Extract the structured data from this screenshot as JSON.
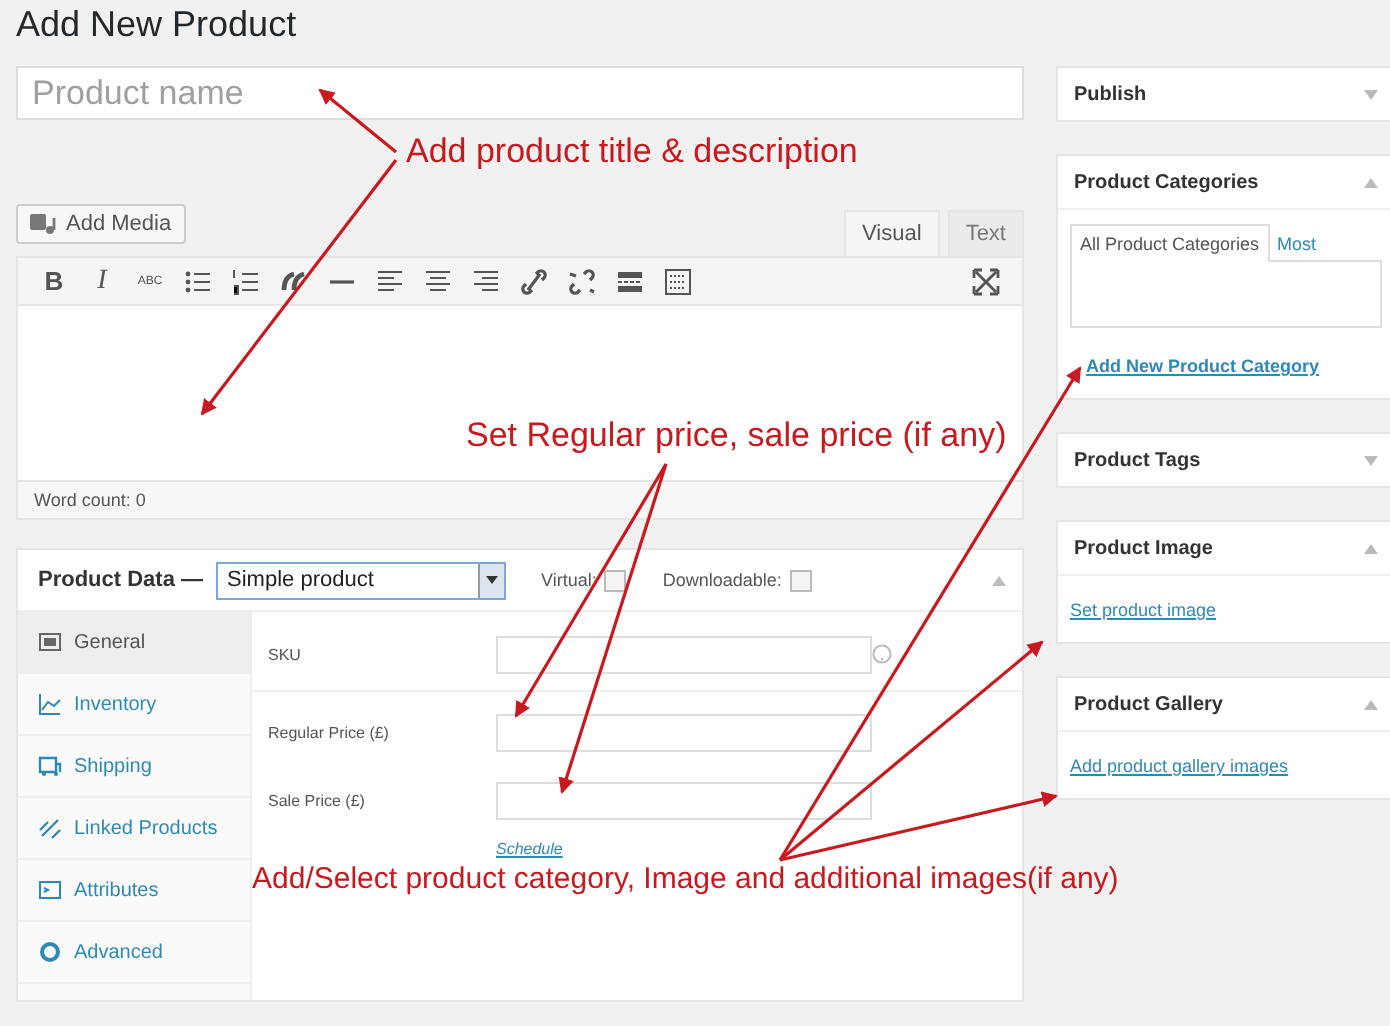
{
  "page_title": "Add New Product",
  "product_name": {
    "placeholder": "Product name"
  },
  "editor": {
    "add_media": "Add Media",
    "tabs": [
      {
        "label": "Visual",
        "selected": true
      },
      {
        "label": "Text",
        "selected": false
      }
    ],
    "toolbar_letters": [
      "B",
      "I",
      "ABC"
    ],
    "word_count": "Word count: 0"
  },
  "product_data": {
    "label": "Product Data —",
    "type_select": "Simple product",
    "options": [
      {
        "label": "Virtual:",
        "checked": false
      },
      {
        "label": "Downloadable:",
        "checked": false
      }
    ],
    "tabs": [
      {
        "label": "General",
        "selected": true
      },
      {
        "label": "Inventory",
        "selected": false
      },
      {
        "label": "Shipping",
        "selected": false
      },
      {
        "label": "Linked Products",
        "selected": false
      },
      {
        "label": "Attributes",
        "selected": false
      },
      {
        "label": "Advanced",
        "selected": false
      }
    ],
    "fields": [
      {
        "label": "SKU",
        "help": true
      },
      {
        "label": "Regular Price (£)",
        "help": false
      },
      {
        "label": "Sale Price (£)",
        "help": false
      }
    ],
    "schedule_link": "Schedule"
  },
  "sidebar": [
    {
      "title": "Publish",
      "expanded": false
    },
    {
      "title": "Product Categories",
      "expanded": true,
      "tabs": [
        {
          "label": "All Product Categories",
          "selected": true
        },
        {
          "label": "Most",
          "selected": false
        }
      ],
      "link": "Add New Product Category"
    },
    {
      "title": "Product Tags",
      "expanded": false
    },
    {
      "title": "Product Image",
      "expanded": true,
      "link": "Set product image"
    },
    {
      "title": "Product Gallery",
      "expanded": true,
      "link": "Add product gallery images"
    }
  ],
  "annotations": [
    {
      "text": "Add product title & description"
    },
    {
      "text": "Set Regular price, sale price (if any)"
    },
    {
      "text": "Add/Select product category, Image and additional images(if any)"
    }
  ]
}
